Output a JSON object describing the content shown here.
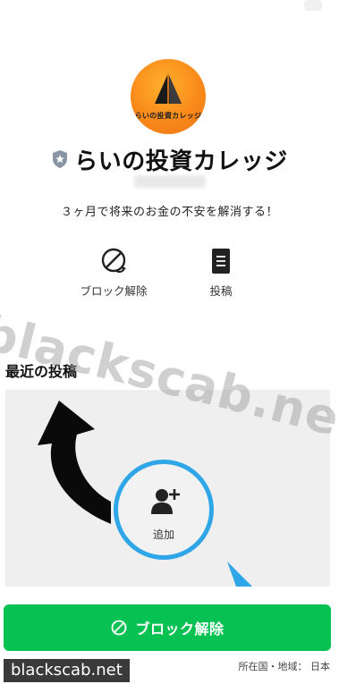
{
  "profile": {
    "name": "らいの投資カレッジ",
    "avatar_text": "らいの投資カレッジ",
    "status_message": "３ヶ月で将来のお金の不安を解消する！",
    "badge_icon": "shield-star-icon"
  },
  "actions": [
    {
      "label": "ブロック解除",
      "icon": "unblock-icon"
    },
    {
      "label": "投稿",
      "icon": "post-icon"
    }
  ],
  "posts": {
    "section_title": "最近の投稿",
    "add_friend_label": "追加"
  },
  "bottom_bar": {
    "unblock_label": "ブロック解除",
    "country_label": "所在国・地域：",
    "country": "日本"
  },
  "watermark": {
    "text": "blackscab.net",
    "brand": "blackscab.net"
  },
  "colors": {
    "accent_green": "#07c153",
    "highlight_blue": "#2ea6e8",
    "avatar_orange": "#f98a1a"
  }
}
